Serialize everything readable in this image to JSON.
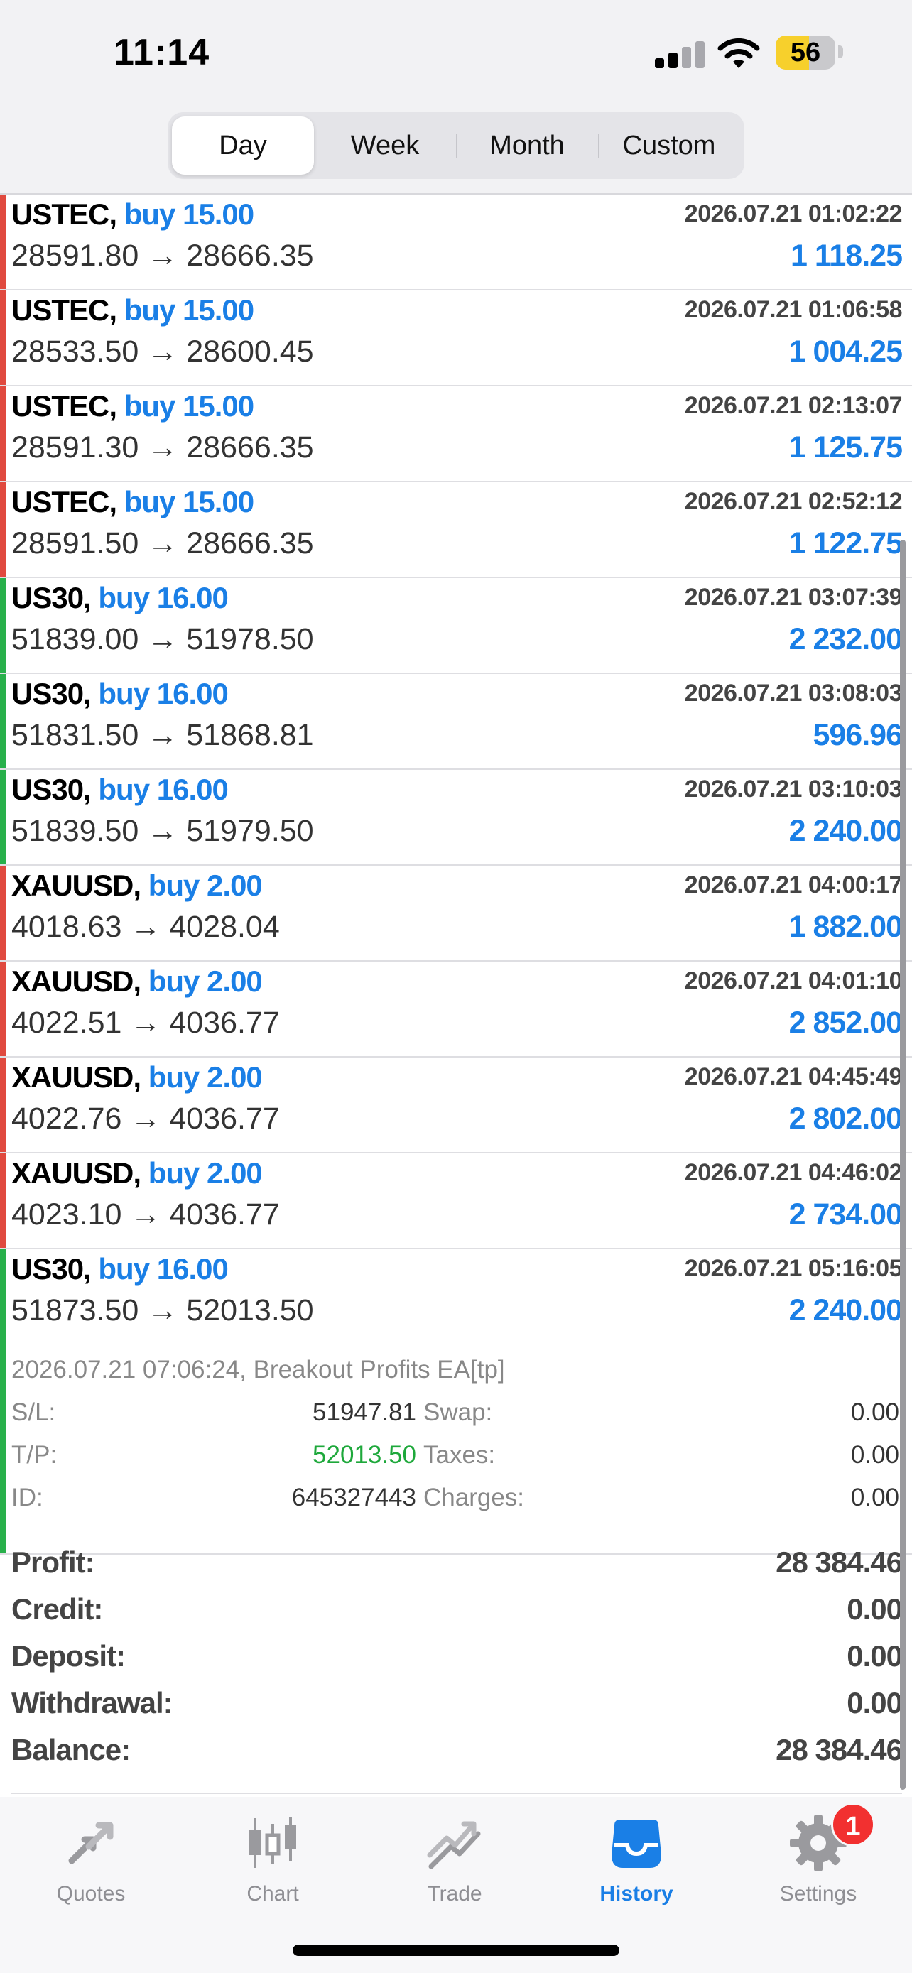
{
  "status": {
    "time": "11:14",
    "battery": "56",
    "battery_level": 0.56
  },
  "periods": [
    {
      "label": "Day",
      "active": true
    },
    {
      "label": "Week",
      "active": false
    },
    {
      "label": "Month",
      "active": false
    },
    {
      "label": "Custom",
      "active": false
    }
  ],
  "colors": {
    "accent": "#1a7fe6",
    "sell_bar": "#e04a3f",
    "buy_bar": "#28b04b",
    "tp": "#1ea83b",
    "badge": "#f23030"
  },
  "deals": [
    {
      "symbol": "USTEC,",
      "side": "buy 15.00",
      "time": "2026.07.21 01:02:22",
      "prices": "28591.80 → 28666.35",
      "profit": "1 118.25",
      "bar": "red"
    },
    {
      "symbol": "USTEC,",
      "side": "buy 15.00",
      "time": "2026.07.21 01:06:58",
      "prices": "28533.50 → 28600.45",
      "profit": "1 004.25",
      "bar": "red"
    },
    {
      "symbol": "USTEC,",
      "side": "buy 15.00",
      "time": "2026.07.21 02:13:07",
      "prices": "28591.30 → 28666.35",
      "profit": "1 125.75",
      "bar": "red"
    },
    {
      "symbol": "USTEC,",
      "side": "buy 15.00",
      "time": "2026.07.21 02:52:12",
      "prices": "28591.50 → 28666.35",
      "profit": "1 122.75",
      "bar": "red"
    },
    {
      "symbol": "US30,",
      "side": "buy 16.00",
      "time": "2026.07.21 03:07:39",
      "prices": "51839.00 → 51978.50",
      "profit": "2 232.00",
      "bar": "green"
    },
    {
      "symbol": "US30,",
      "side": "buy 16.00",
      "time": "2026.07.21 03:08:03",
      "prices": "51831.50 → 51868.81",
      "profit": "596.96",
      "bar": "green"
    },
    {
      "symbol": "US30,",
      "side": "buy 16.00",
      "time": "2026.07.21 03:10:03",
      "prices": "51839.50 → 51979.50",
      "profit": "2 240.00",
      "bar": "green"
    },
    {
      "symbol": "XAUUSD,",
      "side": "buy 2.00",
      "time": "2026.07.21 04:00:17",
      "prices": "4018.63 → 4028.04",
      "profit": "1 882.00",
      "bar": "red"
    },
    {
      "symbol": "XAUUSD,",
      "side": "buy 2.00",
      "time": "2026.07.21 04:01:10",
      "prices": "4022.51 → 4036.77",
      "profit": "2 852.00",
      "bar": "red"
    },
    {
      "symbol": "XAUUSD,",
      "side": "buy 2.00",
      "time": "2026.07.21 04:45:49",
      "prices": "4022.76 → 4036.77",
      "profit": "2 802.00",
      "bar": "red"
    },
    {
      "symbol": "XAUUSD,",
      "side": "buy 2.00",
      "time": "2026.07.21 04:46:02",
      "prices": "4023.10 → 4036.77",
      "profit": "2 734.00",
      "bar": "red"
    }
  ],
  "expanded": {
    "symbol": "US30,",
    "side": "buy 16.00",
    "time": "2026.07.21 05:16:05",
    "prices": "51873.50 → 52013.50",
    "profit": "2 240.00",
    "comment": "2026.07.21 07:06:24, Breakout Profits EA[tp]",
    "sl_label": "S/L:",
    "sl": "51947.81",
    "tp_label": "T/P:",
    "tp": "52013.50",
    "id_label": "ID:",
    "id": "645327443",
    "swap_label": "Swap:",
    "swap": "0.00",
    "taxes_label": "Taxes:",
    "taxes": "0.00",
    "charges_label": "Charges:",
    "charges": "0.00"
  },
  "summary": [
    {
      "label": "Profit:",
      "value": "28 384.46"
    },
    {
      "label": "Credit:",
      "value": "0.00"
    },
    {
      "label": "Deposit:",
      "value": "0.00"
    },
    {
      "label": "Withdrawal:",
      "value": "0.00"
    },
    {
      "label": "Balance:",
      "value": "28 384.46"
    }
  ],
  "tabs": [
    {
      "label": "Quotes",
      "icon": "quotes-icon",
      "active": false
    },
    {
      "label": "Chart",
      "icon": "chart-icon",
      "active": false
    },
    {
      "label": "Trade",
      "icon": "trade-icon",
      "active": false
    },
    {
      "label": "History",
      "icon": "history-icon",
      "active": true
    },
    {
      "label": "Settings",
      "icon": "gear-icon",
      "active": false
    }
  ],
  "settings_badge": "1"
}
